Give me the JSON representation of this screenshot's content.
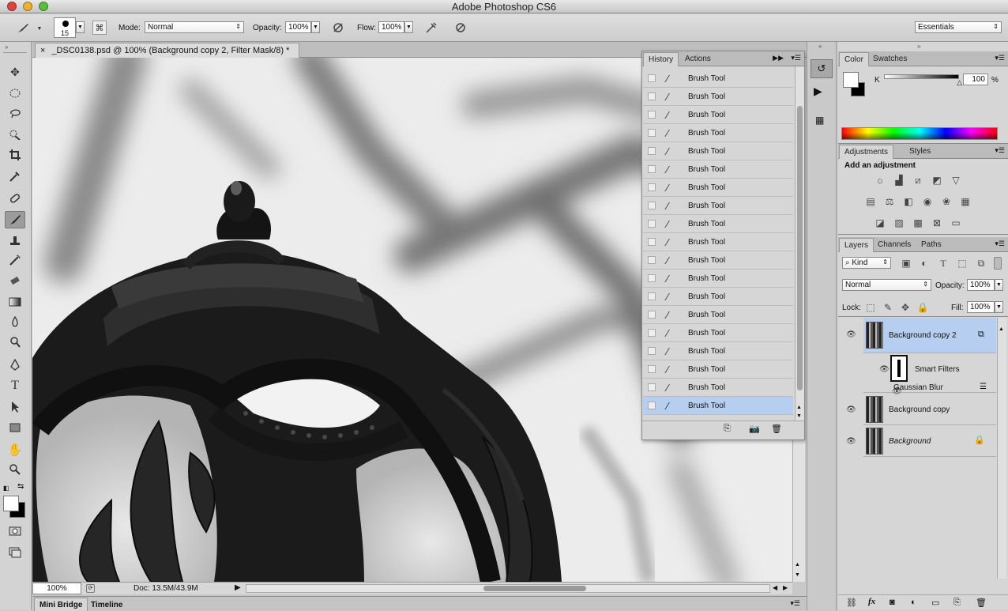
{
  "app": {
    "title": "Adobe Photoshop CS6"
  },
  "colors": {
    "accent": "#b6cef0",
    "canvas_bg": "#e9e9e9",
    "panel_bg": "#d6d6d6"
  },
  "options_bar": {
    "brush_size": "15",
    "mode_label": "Mode:",
    "mode_value": "Normal",
    "opacity_label": "Opacity:",
    "opacity_value": "100%",
    "flow_label": "Flow:",
    "flow_value": "100%",
    "workspace": "Essentials"
  },
  "document": {
    "tab_title": "_DSC0138.psd @ 100% (Background copy 2, Filter Mask/8) *",
    "zoom": "100%",
    "doc_size": "Doc: 13.5M/43.9M"
  },
  "bottom_tabs": [
    "Mini Bridge",
    "Timeline"
  ],
  "history": {
    "tabs": [
      "History",
      "Actions"
    ],
    "items": [
      "Brush Tool",
      "Brush Tool",
      "Brush Tool",
      "Brush Tool",
      "Brush Tool",
      "Brush Tool",
      "Brush Tool",
      "Brush Tool",
      "Brush Tool",
      "Brush Tool",
      "Brush Tool",
      "Brush Tool",
      "Brush Tool",
      "Brush Tool",
      "Brush Tool",
      "Brush Tool",
      "Brush Tool",
      "Brush Tool",
      "Brush Tool"
    ]
  },
  "color_panel": {
    "tabs": [
      "Color",
      "Swatches"
    ],
    "channel": "K",
    "value": "100",
    "unit": "%"
  },
  "adjustments_panel": {
    "tabs": [
      "Adjustments",
      "Styles"
    ],
    "heading": "Add an adjustment"
  },
  "layers_panel": {
    "tabs": [
      "Layers",
      "Channels",
      "Paths"
    ],
    "filter": "Kind",
    "blend_mode": "Normal",
    "opacity_label": "Opacity:",
    "opacity_value": "100%",
    "lock_label": "Lock:",
    "fill_label": "Fill:",
    "fill_value": "100%",
    "layers": [
      {
        "name": "Background copy 2",
        "selected": true
      },
      {
        "name": "Smart Filters"
      },
      {
        "name": "Gaussian Blur"
      },
      {
        "name": "Background copy"
      },
      {
        "name": "Background",
        "locked": true
      }
    ],
    "footer_fx": "fx"
  }
}
